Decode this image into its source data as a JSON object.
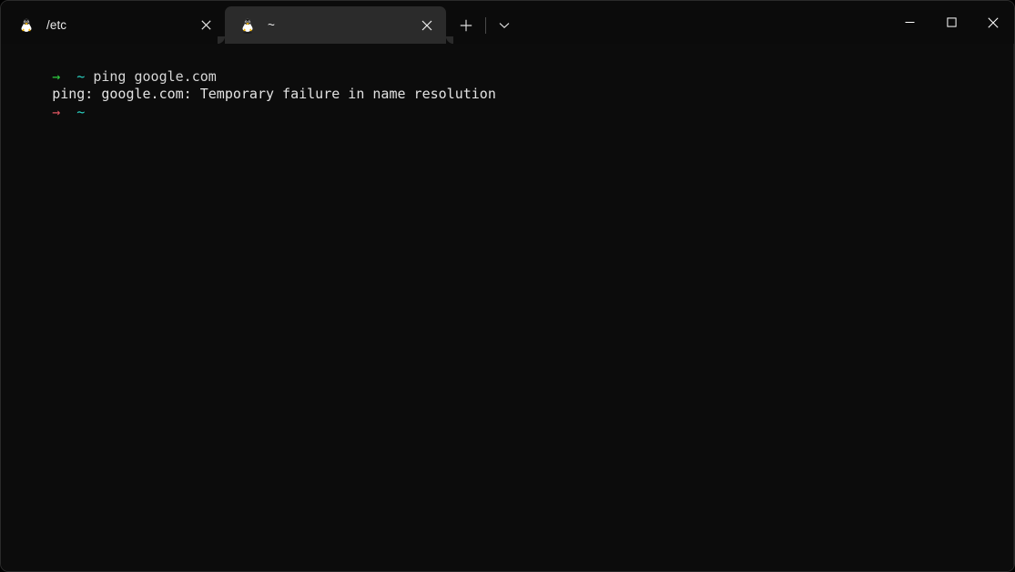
{
  "window": {
    "background_color": "#0c0c0c",
    "titlebar_color": "#0b0b0b",
    "active_tab_color": "#2b2b2b",
    "border_color": "#2a2a2a"
  },
  "titlebar": {
    "tabs": [
      {
        "label": "/etc",
        "icon": "tux-linux-icon",
        "active": false,
        "close_label": "×"
      },
      {
        "label": "~",
        "icon": "tux-linux-icon",
        "active": true,
        "close_label": "×"
      }
    ],
    "new_tab_label": "+",
    "dropdown_label": "⌄",
    "caption": {
      "minimize_label": "─",
      "maximize_label": "□",
      "close_label": "×"
    }
  },
  "terminal": {
    "prompt_arrow": "→",
    "prompt_path": "~",
    "colors": {
      "prompt_success": "#2ecc40",
      "prompt_error": "#e05561",
      "path": "#2ad4c4",
      "command": "#d6d6d6",
      "output": "#e2e2e2"
    },
    "lines": [
      {
        "type": "prompt",
        "arrow": "→",
        "arrow_state": "success",
        "path": "~",
        "command": "ping google.com"
      },
      {
        "type": "output",
        "text": "ping: google.com: Temporary failure in name resolution"
      },
      {
        "type": "prompt",
        "arrow": "→",
        "arrow_state": "error",
        "path": "~",
        "command": ""
      }
    ]
  }
}
